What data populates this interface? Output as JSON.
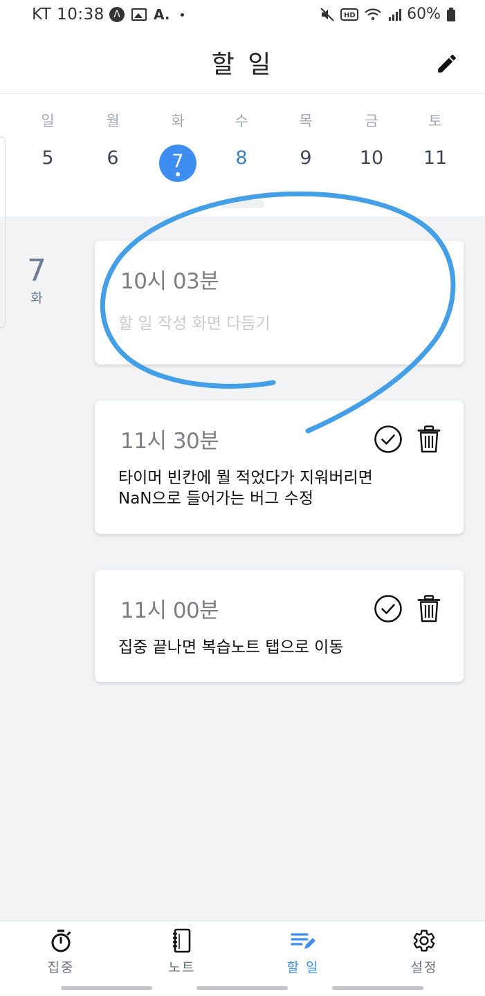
{
  "status_bar": {
    "carrier_time": "KT 10:38",
    "notification_icons": [
      "nav-circle-icon",
      "image-icon",
      "a-letter-icon",
      "dot-icon"
    ],
    "a_letter": "A.",
    "nav_letter": "Λ",
    "battery": "60%"
  },
  "header": {
    "title": "할 일",
    "edit_icon": "pencil-icon"
  },
  "week": {
    "days": [
      {
        "name": "일",
        "num": "5"
      },
      {
        "name": "월",
        "num": "6"
      },
      {
        "name": "화",
        "num": "7"
      },
      {
        "name": "수",
        "num": "8"
      },
      {
        "name": "목",
        "num": "9"
      },
      {
        "name": "금",
        "num": "10"
      },
      {
        "name": "토",
        "num": "11"
      }
    ],
    "selected_index": 2
  },
  "date_label": {
    "num": "7",
    "dow": "화"
  },
  "todos": [
    {
      "time": "10시 03분",
      "text": "할 일 작성 화면 다듬기",
      "is_draft": true
    },
    {
      "time": "11시 30분",
      "text_line1": "타이머 빈칸에 뭘 적었다가 지워버리면",
      "text_line2": "NaN으로 들어가는 버그 수정"
    },
    {
      "time": "11시 00분",
      "text": "집중 끝나면 복습노트 탭으로 이동"
    }
  ],
  "bottom_nav": {
    "tabs": [
      {
        "label": "집중",
        "icon": "stopwatch-icon"
      },
      {
        "label": "노트",
        "icon": "notebook-icon"
      },
      {
        "label": "할 일",
        "icon": "todo-list-icon",
        "active": true
      },
      {
        "label": "설정",
        "icon": "gear-icon"
      }
    ]
  },
  "colors": {
    "accent": "#3d8ef0",
    "annotation": "#3a9ae6",
    "content_bg": "#f1f3f5"
  }
}
